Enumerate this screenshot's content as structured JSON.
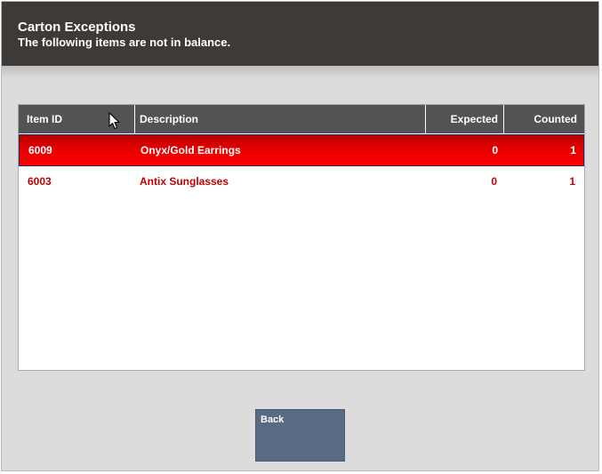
{
  "header": {
    "title": "Carton Exceptions",
    "subtitle": "The following items are not in balance."
  },
  "table": {
    "columns": [
      "Item ID",
      "Description",
      "Expected",
      "Counted"
    ],
    "rows": [
      {
        "item_id": "6009",
        "description": "Onyx/Gold Earrings",
        "expected": "0",
        "counted": "1",
        "selected": true
      },
      {
        "item_id": "6003",
        "description": "Antix Sunglasses",
        "expected": "0",
        "counted": "1",
        "selected": false
      }
    ]
  },
  "actions": {
    "back_label": "Back"
  },
  "colors": {
    "header_bg": "#3d3a37",
    "table_header_bg": "#535353",
    "selected_row": "#e60000",
    "row_text": "#c00000",
    "button_bg": "#576b82"
  },
  "icons": {
    "cursor": "mouse-pointer-icon"
  }
}
